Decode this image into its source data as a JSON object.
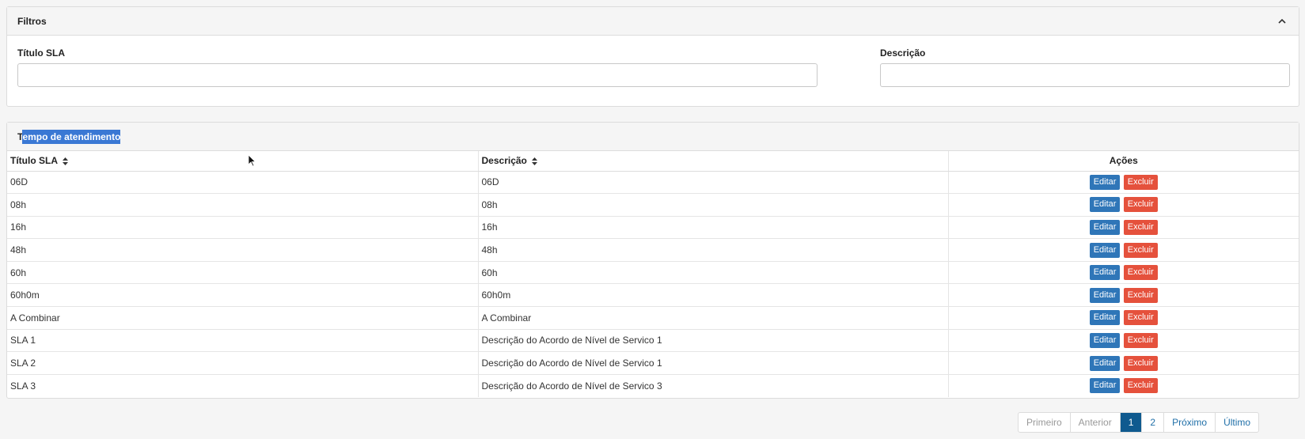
{
  "filters": {
    "title": "Filtros",
    "titulo_label": "Título SLA",
    "titulo_value": "",
    "descricao_label": "Descrição",
    "descricao_value": ""
  },
  "results": {
    "title_first": "T",
    "title_rest": "empo de atendimento",
    "columns": {
      "titulo": "Título SLA",
      "descricao": "Descrição",
      "acoes": "Ações"
    },
    "edit_label": "Editar",
    "delete_label": "Excluir",
    "rows": [
      {
        "titulo": "06D",
        "descricao": "06D"
      },
      {
        "titulo": "08h",
        "descricao": "08h"
      },
      {
        "titulo": "16h",
        "descricao": "16h"
      },
      {
        "titulo": "48h",
        "descricao": "48h"
      },
      {
        "titulo": "60h",
        "descricao": "60h"
      },
      {
        "titulo": "60h0m",
        "descricao": "60h0m"
      },
      {
        "titulo": "A Combinar",
        "descricao": "A Combinar"
      },
      {
        "titulo": "SLA 1",
        "descricao": "Descrição do Acordo de Nível de Servico 1"
      },
      {
        "titulo": "SLA 2",
        "descricao": "Descrição do Acordo de Nível de Servico 1"
      },
      {
        "titulo": "SLA 3",
        "descricao": "Descrição do Acordo de Nível de Servico 3"
      }
    ]
  },
  "pagination": {
    "first": "Primeiro",
    "prev": "Anterior",
    "page1": "1",
    "page2": "2",
    "next": "Próximo",
    "last": "Último"
  },
  "icons": {
    "collapse": "chevron-up-icon",
    "sort": "sort-icon",
    "pointer": "mouse-cursor-icon"
  },
  "colors": {
    "edit": "#2f76b8",
    "delete": "#e5513c",
    "active_page": "#0f5a8f",
    "selection": "#3a78d4"
  }
}
